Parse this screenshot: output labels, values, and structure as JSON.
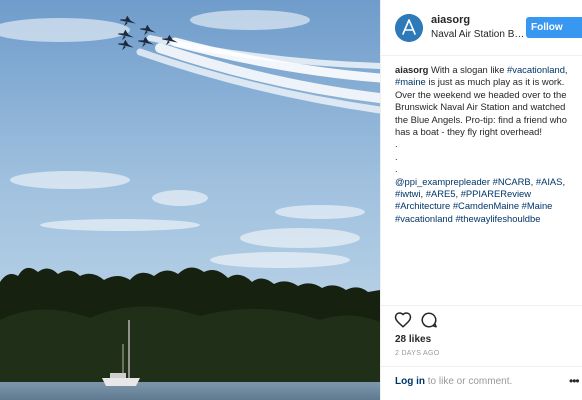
{
  "post": {
    "image": {
      "subject": "blue-angels-over-maine-harbor"
    },
    "header": {
      "username": "aiasorg",
      "location": "Naval Air Station Bru...",
      "follow_label": "Follow"
    },
    "caption": {
      "username": "aiasorg",
      "text_1": " With a slogan like ",
      "tag_vacationland": "#vacationland",
      "text_2": ",",
      "tag_maine": "#maine",
      "text_3": " is just as much play as it is work.",
      "line_3": "Over the weekend we headed over to the",
      "line_4": "Brunswick Naval Air Station and watched",
      "line_5": "the Blue Angels. Pro-tip: find a friend who",
      "line_6": "has a boat - they fly right overhead!",
      "dot": ".",
      "mention": "@ppi_examprepleader",
      "tag_ncarb": "#NCARB",
      "tag_aias": "#AIAS",
      "tag_iwtwi": "#iwtwi",
      "tag_are5": "#ARE5",
      "tag_ppiare": "#PPIAREReview",
      "tag_architecture": "#Architecture",
      "tag_camdenmaine": "#CamdenMaine",
      "tag_maine2": "#Maine",
      "tag_vacationland2": "#vacationland",
      "tag_thewaylife": "#thewaylifeshouldbe",
      "sep_comma": ", ",
      "sep_space": " "
    },
    "actions": {
      "like_icon": "heart-outline-icon",
      "comment_icon": "comment-bubble-icon"
    },
    "likes_text": "28 likes",
    "timestamp": "2 DAYS AGO",
    "comment_box": {
      "login_label": "Log in",
      "prompt": " to like or comment.",
      "more_icon": "more-options-icon"
    },
    "colors": {
      "link": "#003569",
      "follow_button": "#3897f0",
      "muted_text": "#999999"
    }
  }
}
